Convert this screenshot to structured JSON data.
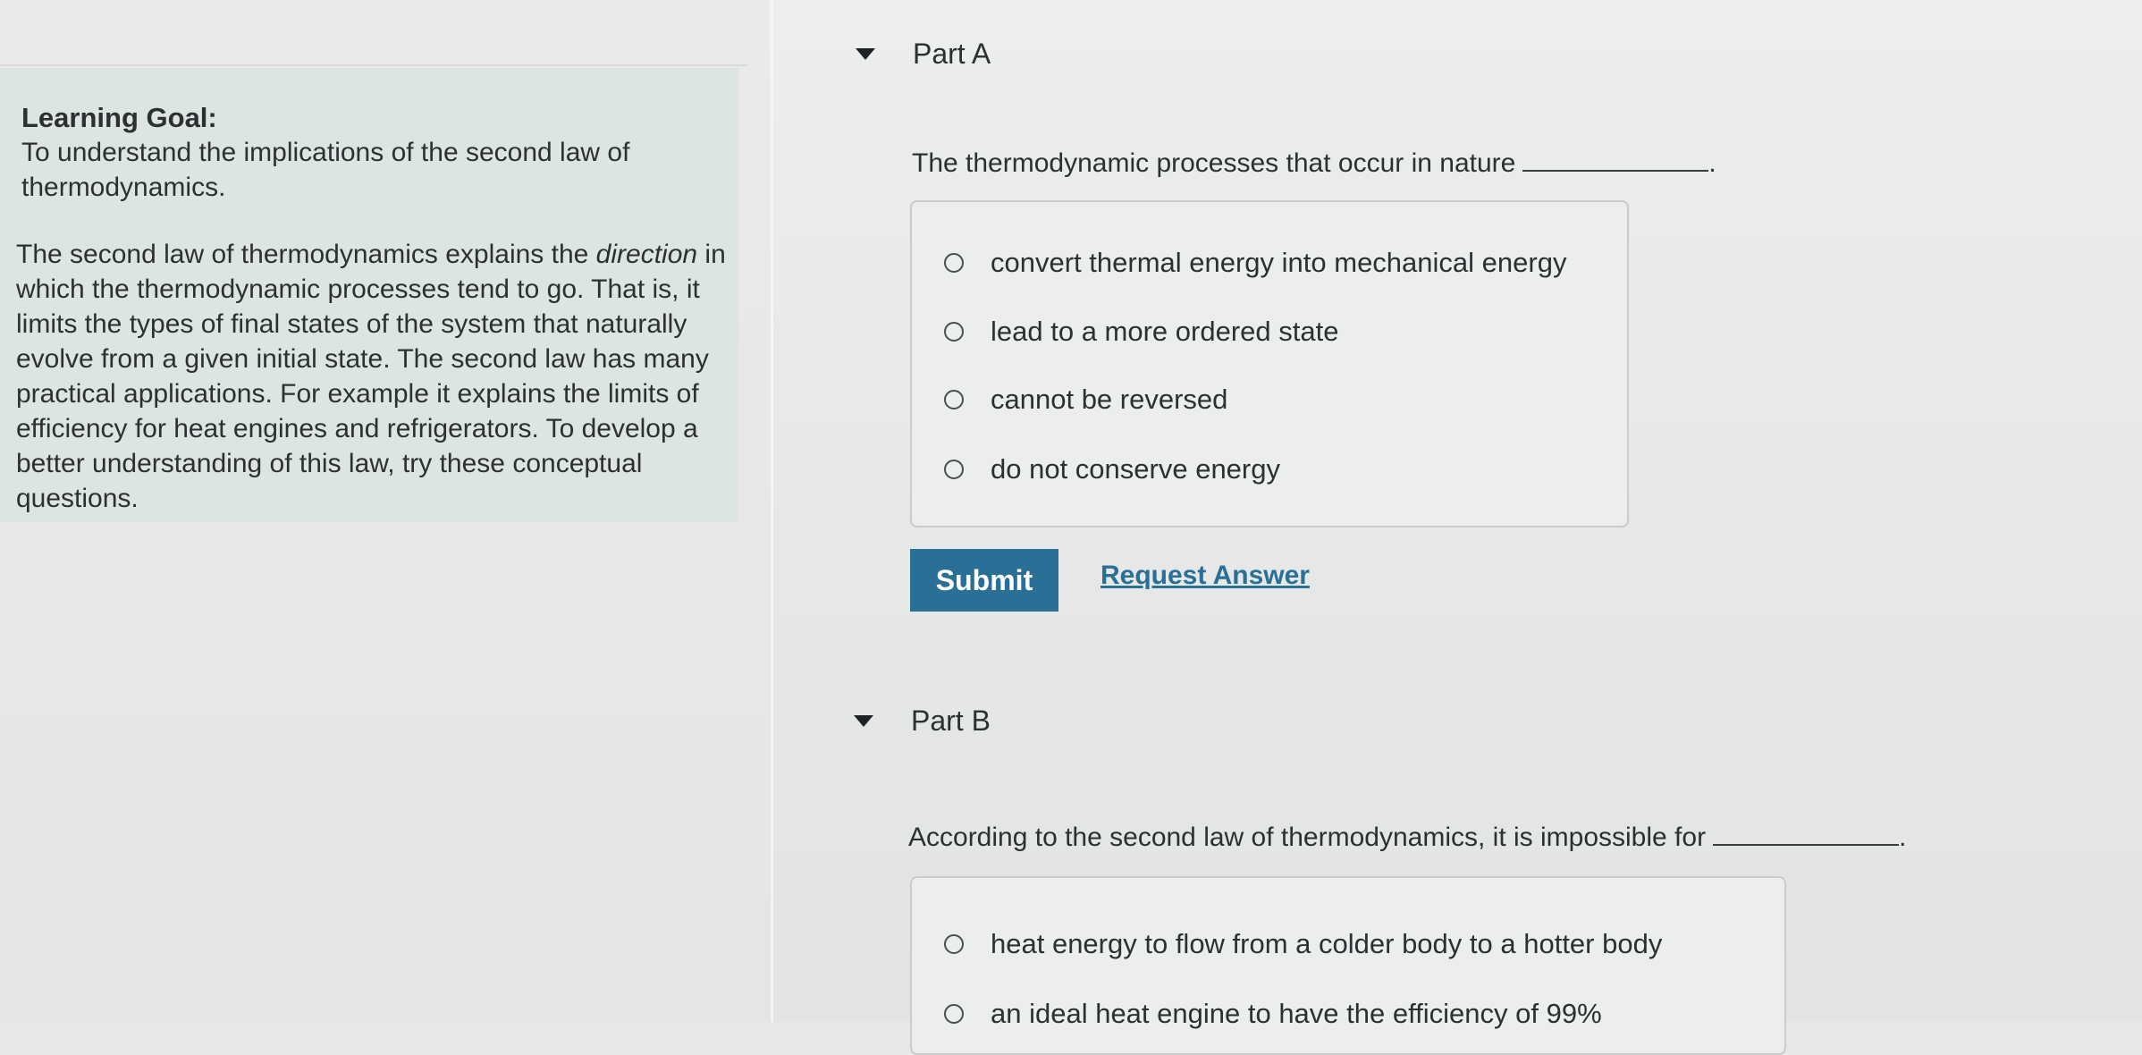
{
  "learning_goal": {
    "heading": "Learning Goal:",
    "intro": "To understand the implications of the second law of thermodynamics.",
    "body_before": "The second law of thermodynamics explains the ",
    "body_em": "direction",
    "body_after": " in which the thermodynamic processes tend to go. That is, it limits the types of final states of the system that naturally evolve from a given initial state. The second law has many practical applications. For example it explains the limits of efficiency for heat engines and refrigerators. To develop a better understanding of this law, try these conceptual questions."
  },
  "part_a": {
    "title": "Part A",
    "question": "The thermodynamic processes that occur in nature",
    "question_end": ".",
    "choices": [
      "convert thermal energy into mechanical energy",
      "lead to a more ordered state",
      "cannot be reversed",
      "do not conserve energy"
    ],
    "submit_label": "Submit",
    "request_label": "Request Answer"
  },
  "part_b": {
    "title": "Part B",
    "question": "According to the second law of thermodynamics, it is impossible for",
    "question_end": ".",
    "choices": [
      "heat energy to flow from a colder body to a hotter body",
      "an ideal heat engine to have the efficiency of 99%"
    ]
  },
  "colors": {
    "accent": "#2a6f96",
    "goal_background": "#dde5e2"
  }
}
